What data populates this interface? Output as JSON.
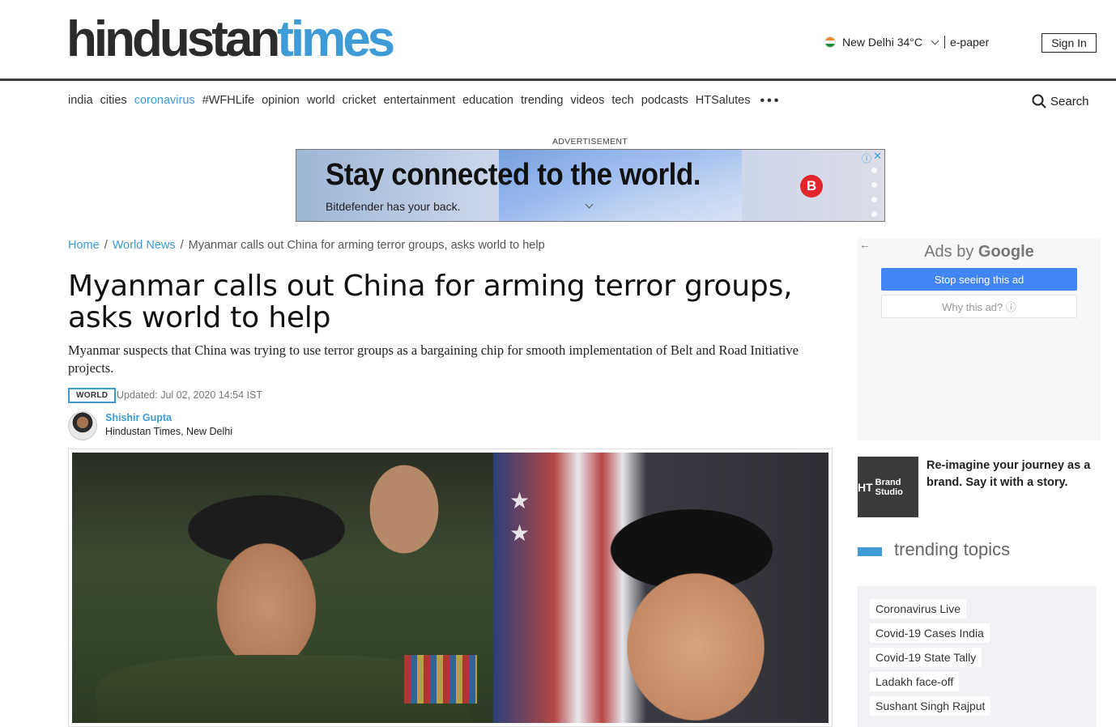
{
  "header": {
    "logo_part1": "hindustan",
    "logo_part2": "times",
    "location": "New Delhi 34°C",
    "epaper": "e-paper",
    "signin": "Sign In",
    "search_label": "Search"
  },
  "nav": {
    "items": [
      "india",
      "cities",
      "coronavirus",
      "#WFHLife",
      "opinion",
      "world",
      "cricket",
      "entertainment",
      "education",
      "trending",
      "videos",
      "tech",
      "podcasts",
      "HTSalutes"
    ],
    "more": "•••"
  },
  "ad_banner": {
    "label": "ADVERTISEMENT",
    "headline": "Stay connected to the world.",
    "subline": "Bitdefender has your back.",
    "brand_badge": "B"
  },
  "breadcrumb": {
    "home": "Home",
    "section": "World News",
    "current": "Myanmar calls out China for arming terror groups, asks world to help"
  },
  "article": {
    "title": "Myanmar calls out China for arming terror groups, asks world to help",
    "summary": "Myanmar suspects that China was trying to use terror groups as a bargaining chip for smooth implementation of Belt and Road Initiative projects.",
    "section_tag": "WORLD",
    "updated": "Updated: Jul 02, 2020 14:54 IST",
    "author": "Shishir Gupta",
    "author_org": "Hindustan Times, New Delhi"
  },
  "sidebar": {
    "google_ad": {
      "ads_by": "Ads by",
      "google": "Google",
      "stop": "Stop seeing this ad",
      "why": "Why this ad? ⓘ"
    },
    "brand_studio": {
      "tile_ht": "HT",
      "tile_text": "Brand Studio",
      "text": "Re-imagine your journey as a brand. Say it with a story."
    },
    "trending": {
      "title": "trending topics",
      "topics": [
        "Coronavirus Live",
        "Covid-19 Cases India",
        "Covid-19 State Tally",
        "Ladakh face-off",
        "Sushant Singh Rajput"
      ]
    }
  },
  "colors": {
    "accent": "#3e9bd5",
    "header_rule": "#3c3c3c",
    "google_blue": "#4285f4",
    "bitdefender_red": "#e3262b"
  }
}
